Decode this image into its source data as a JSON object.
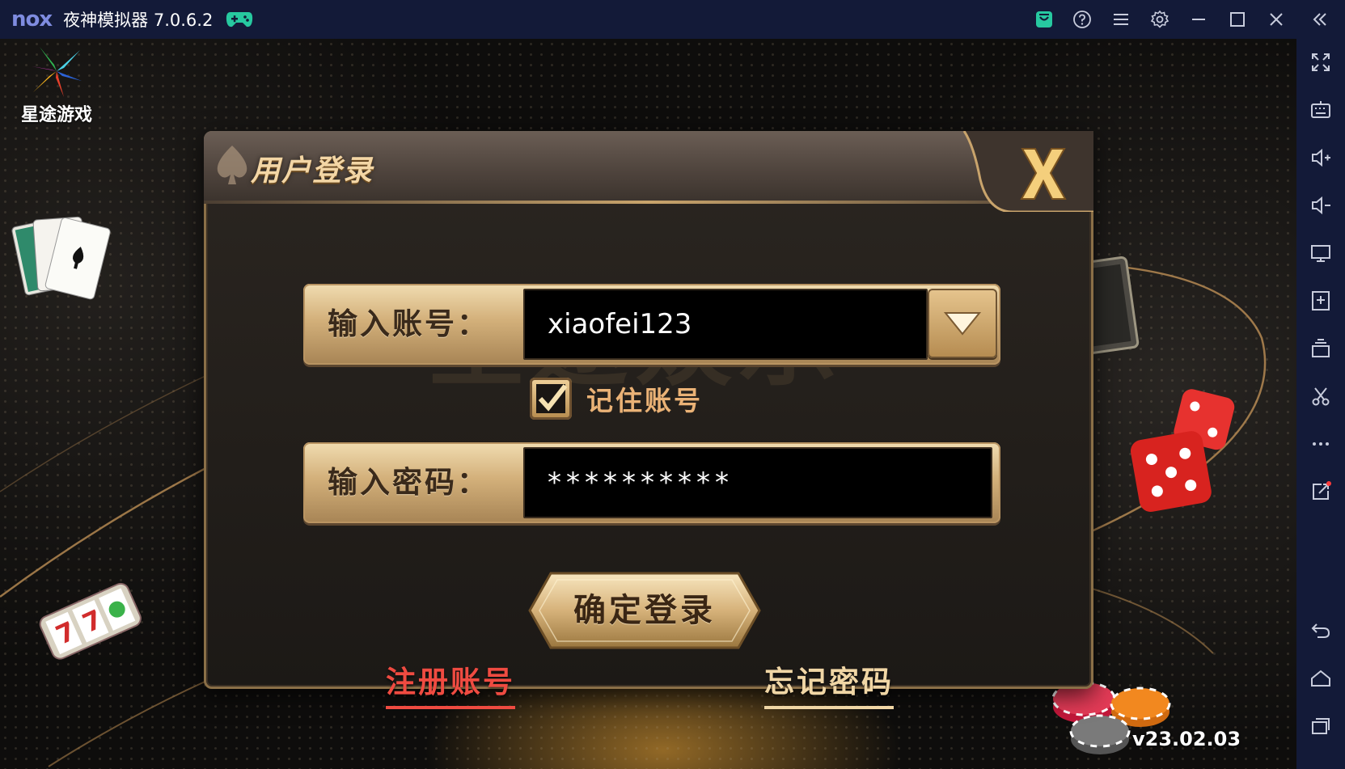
{
  "window": {
    "logo_text": "nox",
    "title": "夜神模拟器 7.0.6.2",
    "icons": [
      "gamepad-icon",
      "store-icon",
      "help-icon",
      "menu-icon",
      "settings-icon",
      "minimize-icon",
      "maximize-icon",
      "close-icon",
      "collapse-sidebar-icon"
    ],
    "colors": {
      "titlebar": "#131a38",
      "logo": "#7f8ce0",
      "store_accent": "#27c9a0"
    }
  },
  "sidebar": {
    "items": [
      "fullscreen-icon",
      "keyboard-icon",
      "volume-up-icon",
      "volume-down-icon",
      "screen-icon",
      "apk-install-icon",
      "multi-instance-icon",
      "screenshot-scissors-icon",
      "more-icon",
      "share-icon",
      "back-icon",
      "home-icon",
      "recent-apps-icon"
    ]
  },
  "game": {
    "brand_text": "星途游戏",
    "watermark": "星途娱乐",
    "version": "v23.02.03"
  },
  "dialog": {
    "title": "用户登录",
    "account": {
      "label": "输入账号：",
      "value": "xiaofei123"
    },
    "remember": {
      "label": "记住账号",
      "checked": true
    },
    "password": {
      "label": "输入密码：",
      "value": "**********"
    },
    "login_button": "确定登录",
    "register_link": "注册账号",
    "forgot_link": "忘记密码",
    "colors": {
      "gold": "#d3b07a",
      "register": "#ef4b41",
      "forgot": "#f0d6a5",
      "remember": "#eab276"
    }
  }
}
